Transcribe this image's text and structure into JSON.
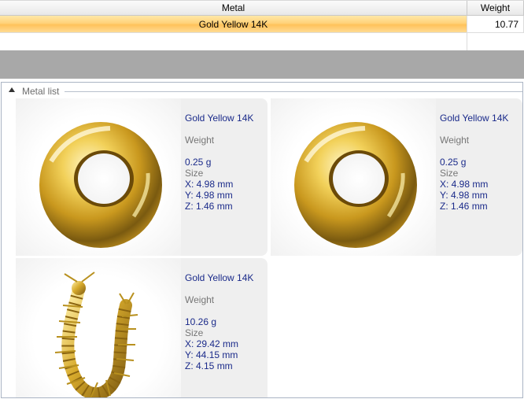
{
  "grid": {
    "columns": {
      "metal": "Metal",
      "weight": "Weight"
    },
    "rows": [
      {
        "metal": "Gold Yellow 14K",
        "weight": "10.77",
        "selected": true
      }
    ]
  },
  "panel": {
    "title": "Metal list",
    "cards": [
      {
        "name": "Gold Yellow 14K",
        "weight_label": "Weight",
        "weight": "0.25 g",
        "size_label": "Size",
        "x": "X: 4.98 mm",
        "y": "Y: 4.98 mm",
        "z": "Z: 1.46 mm",
        "image": "gold-ring-icon"
      },
      {
        "name": "Gold Yellow 14K",
        "weight_label": "Weight",
        "weight": "0.25 g",
        "size_label": "Size",
        "x": "X: 4.98 mm",
        "y": "Y: 4.98 mm",
        "z": "Z: 1.46 mm",
        "image": "gold-ring-icon"
      },
      {
        "name": "Gold Yellow 14K",
        "weight_label": "Weight",
        "weight": "10.26 g",
        "size_label": "Size",
        "x": "X: 29.42 mm",
        "y": "Y: 44.15 mm",
        "z": "Z: 4.15 mm",
        "image": "gold-centipede-icon"
      }
    ]
  },
  "colors": {
    "selection": "#ffc25a",
    "value_text": "#1a2a8a",
    "label_text": "#777777",
    "info_bg": "#efefef",
    "gold": "#d4a017"
  }
}
